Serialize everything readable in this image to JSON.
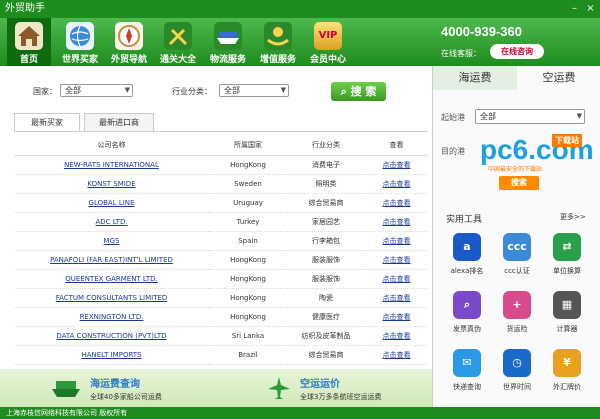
{
  "window": {
    "title": "外贸助手",
    "minimize": "–",
    "close": "×"
  },
  "nav": [
    {
      "label": "首页",
      "icon": "house-icon"
    },
    {
      "label": "世界买家",
      "icon": "globe-icon"
    },
    {
      "label": "外贸导航",
      "icon": "compass-icon"
    },
    {
      "label": "通关大全",
      "icon": "tools-icon"
    },
    {
      "label": "物流服务",
      "icon": "ship-icon"
    },
    {
      "label": "增值服务",
      "icon": "hands-icon"
    },
    {
      "label": "会员中心",
      "icon": "vip-icon"
    }
  ],
  "vip_badge": "VIP",
  "header": {
    "phone": "4000-939-360",
    "online_label": "在线客服：",
    "online_button": "在线咨询"
  },
  "filters": {
    "country_label": "国家：",
    "country_value": "全部",
    "industry_label": "行业分类：",
    "industry_value": "全部",
    "search_button": "搜 索"
  },
  "tabs": [
    {
      "label": "最新买家"
    },
    {
      "label": "最新进口商"
    }
  ],
  "table": {
    "headers": [
      "公司名称",
      "所属国家",
      "行业分类",
      "查看"
    ],
    "rows": [
      {
        "company": "NEW-RATS INTERNATIONAL",
        "country": "HongKong",
        "industry": "消费电子",
        "view": "点击查看"
      },
      {
        "company": "KONST SMIDE",
        "country": "Sweden",
        "industry": "照明类",
        "view": "点击查看"
      },
      {
        "company": "GLOBAL LINE",
        "country": "Uruguay",
        "industry": "综合贸易商",
        "view": "点击查看"
      },
      {
        "company": "ADC LTD.",
        "country": "Turkey",
        "industry": "家居园艺",
        "view": "点击查看"
      },
      {
        "company": "MGS",
        "country": "Spain",
        "industry": "行李箱包",
        "view": "点击查看"
      },
      {
        "company": "PANAFOLI (FAR EAST)INT'L LIMITED",
        "country": "HongKong",
        "industry": "服装服饰",
        "view": "点击查看"
      },
      {
        "company": "QUEENTEX GARMENT LTD.",
        "country": "HongKong",
        "industry": "服装服饰",
        "view": "点击查看"
      },
      {
        "company": "FACTUM CONSULTANTS LIMITED",
        "country": "HongKong",
        "industry": "陶瓷",
        "view": "点击查看"
      },
      {
        "company": "REXNINGTON LTD.",
        "country": "HongKong",
        "industry": "健康医疗",
        "view": "点击查看"
      },
      {
        "company": "DATA CONSTRUCTION (PVT)LTD",
        "country": "Sri Lanka",
        "industry": "纺织及皮革制品",
        "view": "点击查看"
      },
      {
        "company": "HANELT IMPORTS",
        "country": "Brazil",
        "industry": "综合贸易商",
        "view": "点击查看"
      }
    ]
  },
  "promo": [
    {
      "title": "海运费查询",
      "subtitle": "全球40多家船公司运费"
    },
    {
      "title": "空运运价",
      "subtitle": "全球3万多条航班空运运费"
    }
  ],
  "footer": "上海赤枝信网络科技有限公司  版权所有",
  "right": {
    "tabs": [
      {
        "label": "海运费"
      },
      {
        "label": "空运费"
      }
    ],
    "start_port_label": "起始港",
    "start_port_value": "全部",
    "dest_port_label": "目的港",
    "watermark": {
      "main": "pc6.com",
      "tag": "下载站",
      "sub": "中国最安全的下载站"
    },
    "search_button": "搜索",
    "tools_title": "实用工具",
    "more": "更多>>",
    "tools": [
      {
        "label": "alexa排名",
        "icon": "alexa-icon"
      },
      {
        "label": "ccc认证",
        "icon": "ccc-icon"
      },
      {
        "label": "单位换算",
        "icon": "convert-icon"
      },
      {
        "label": "发票真伪",
        "icon": "magnifier-icon"
      },
      {
        "label": "货运险",
        "icon": "insurance-icon"
      },
      {
        "label": "计算器",
        "icon": "calculator-icon"
      },
      {
        "label": "快递查询",
        "icon": "express-icon"
      },
      {
        "label": "世界时间",
        "icon": "clock-icon"
      },
      {
        "label": "外汇牌价",
        "icon": "currency-icon"
      }
    ]
  }
}
